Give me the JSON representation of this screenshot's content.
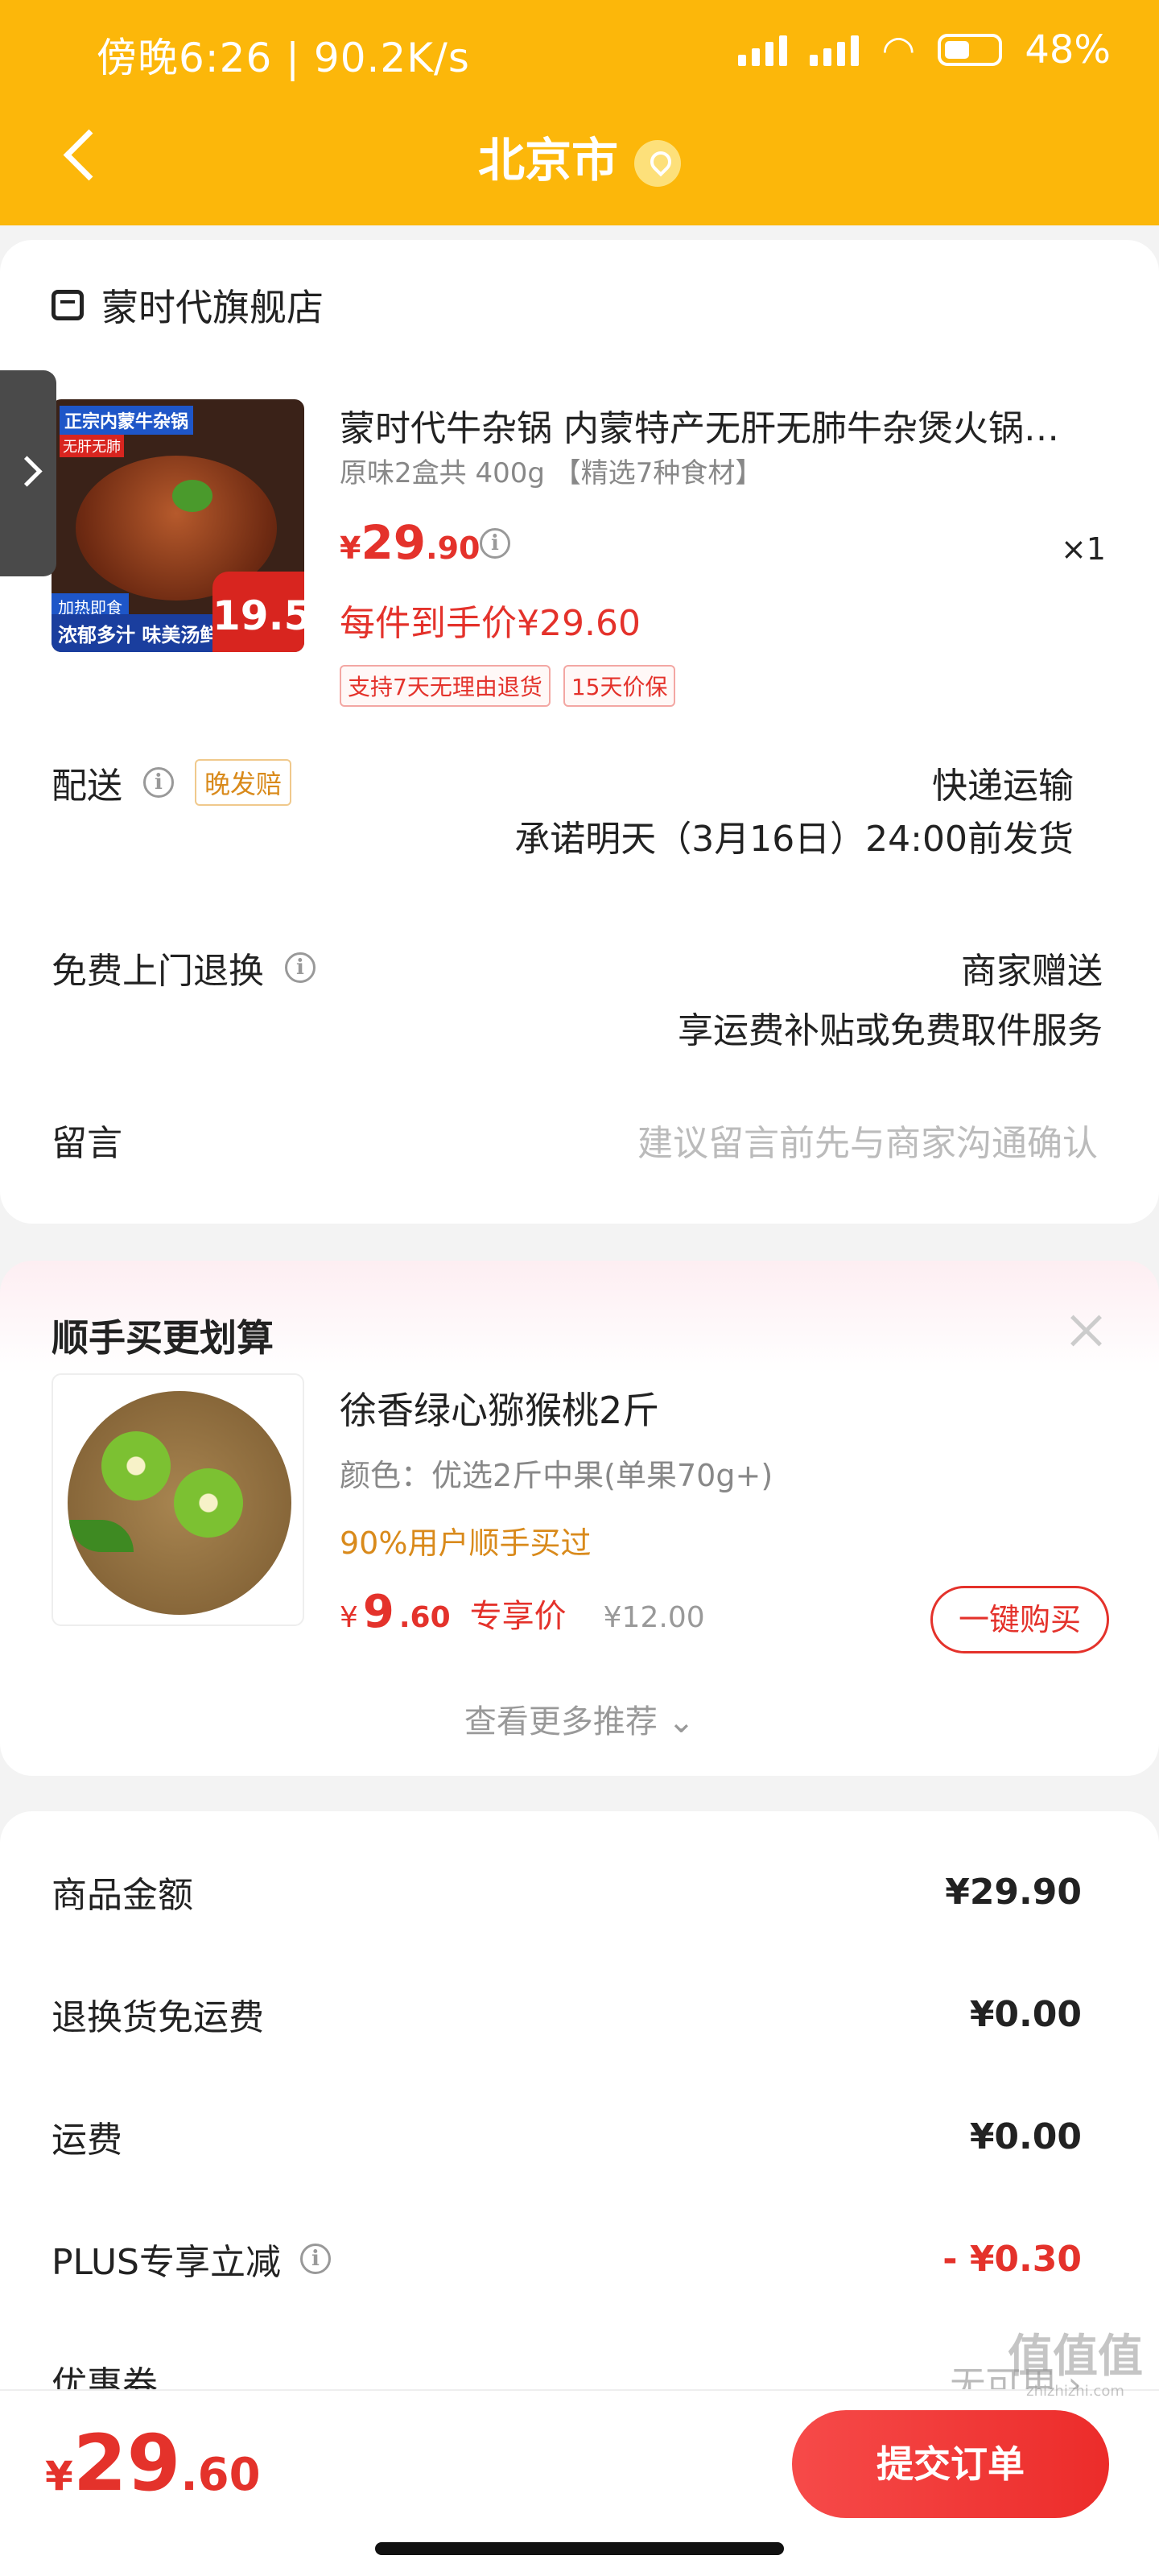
{
  "status_bar": {
    "time_speed": "傍晚6:26 | 90.2K/s",
    "battery": "48%"
  },
  "nav": {
    "title": "北京市"
  },
  "shop": {
    "name": "蒙时代旗舰店"
  },
  "product": {
    "image_texts": {
      "tag1": "正宗内蒙牛杂锅",
      "tag2": "无肝无肺",
      "bottom1": "加热即食",
      "bottom2": "浓郁多汁 味美汤鲜",
      "price_tag": "19.5"
    },
    "title": "蒙时代牛杂锅 内蒙特产无肝无肺牛杂煲火锅…",
    "spec": "原味2盒共 400g 【精选7种食材】",
    "price": {
      "currency": "¥",
      "int": "29",
      "dec": ".90"
    },
    "qty": "×1",
    "per_price": "每件到手价¥29.60",
    "badges": [
      "支持7天无理由退货",
      "15天价保"
    ]
  },
  "delivery": {
    "label": "配送",
    "badge": "晚发赔",
    "method": "快递运输",
    "promise": "承诺明天（3月16日）24:00前发货"
  },
  "return_service": {
    "label": "免费上门退换",
    "right1": "商家赠送",
    "right2": "享运费补贴或免费取件服务"
  },
  "message": {
    "label": "留言",
    "placeholder": "建议留言前先与商家沟通确认"
  },
  "recommend": {
    "title": "顺手买更划算",
    "name": "徐香绿心猕猴桃2斤",
    "spec": "颜色：优选2斤中果(单果70g+)",
    "hint": "90%用户顺手买过",
    "price": {
      "currency": "¥",
      "int": "9",
      "dec": ".60"
    },
    "price_label": "专享价",
    "old_price": "¥12.00",
    "buy_label": "一键购买",
    "more": "查看更多推荐 ⌄"
  },
  "fees": [
    {
      "label": "商品金额",
      "value": "¥29.90"
    },
    {
      "label": "退换货免运费",
      "value": "¥0.00"
    },
    {
      "label": "运费",
      "value": "¥0.00"
    },
    {
      "label": "PLUS专享立减",
      "value": "- ¥0.30"
    },
    {
      "label": "优惠券",
      "value": "无可用 ›"
    }
  ],
  "bottom": {
    "total": {
      "currency": "¥",
      "int": "29",
      "dec": ".60"
    },
    "submit_label": "提交订单"
  },
  "watermark": {
    "text": "值值值",
    "domain": "zhizhizhi.com"
  },
  "colors": {
    "header": "#fcb70a",
    "accent_red": "#e4322b",
    "orange": "#d98a1b"
  }
}
